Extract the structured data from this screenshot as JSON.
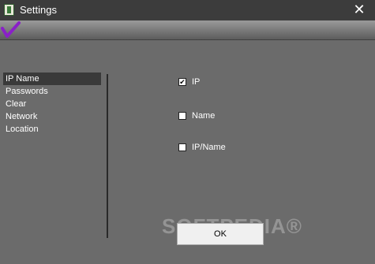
{
  "window": {
    "title": "Settings",
    "close_glyph": "✕",
    "icon": "app-icon"
  },
  "banner": {
    "logo": "purple-check-logo"
  },
  "sidebar": {
    "items": [
      {
        "label": "IP Name",
        "selected": true
      },
      {
        "label": "Passwords"
      },
      {
        "label": "Clear"
      },
      {
        "label": "Network"
      },
      {
        "label": "Location"
      }
    ]
  },
  "options": [
    {
      "label": "IP",
      "checked": true
    },
    {
      "label": "Name",
      "checked": false
    },
    {
      "label": "IP/Name",
      "checked": false
    }
  ],
  "footer": {
    "ok_label": "OK"
  },
  "watermark": "SOFTPEDIA®",
  "colors": {
    "background": "#6b6b6b",
    "titlebar": "#3c3c3c",
    "selected_item": "#3a3a3a",
    "logo": "#8a20c8"
  }
}
